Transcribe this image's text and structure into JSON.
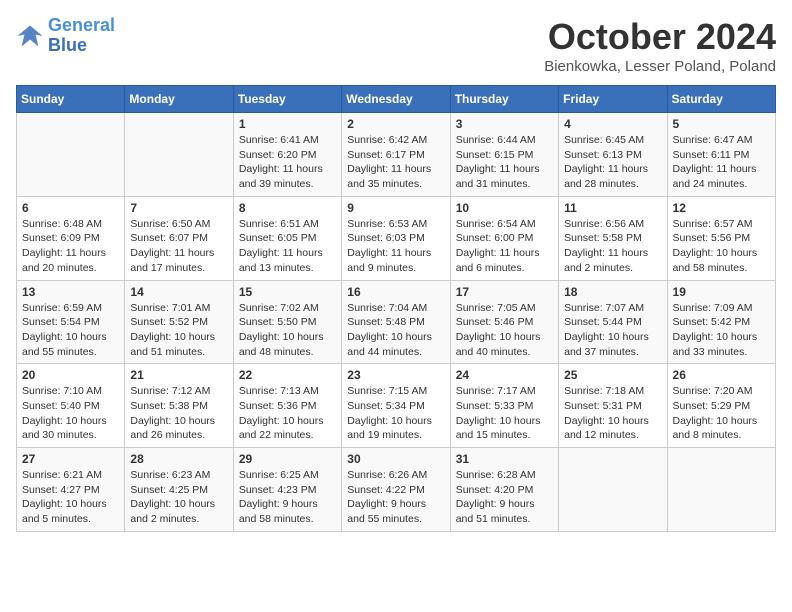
{
  "header": {
    "logo_line1": "General",
    "logo_line2": "Blue",
    "month": "October 2024",
    "location": "Bienkowka, Lesser Poland, Poland"
  },
  "days_of_week": [
    "Sunday",
    "Monday",
    "Tuesday",
    "Wednesday",
    "Thursday",
    "Friday",
    "Saturday"
  ],
  "weeks": [
    [
      {
        "day": "",
        "info": ""
      },
      {
        "day": "",
        "info": ""
      },
      {
        "day": "1",
        "info": "Sunrise: 6:41 AM\nSunset: 6:20 PM\nDaylight: 11 hours and 39 minutes."
      },
      {
        "day": "2",
        "info": "Sunrise: 6:42 AM\nSunset: 6:17 PM\nDaylight: 11 hours and 35 minutes."
      },
      {
        "day": "3",
        "info": "Sunrise: 6:44 AM\nSunset: 6:15 PM\nDaylight: 11 hours and 31 minutes."
      },
      {
        "day": "4",
        "info": "Sunrise: 6:45 AM\nSunset: 6:13 PM\nDaylight: 11 hours and 28 minutes."
      },
      {
        "day": "5",
        "info": "Sunrise: 6:47 AM\nSunset: 6:11 PM\nDaylight: 11 hours and 24 minutes."
      }
    ],
    [
      {
        "day": "6",
        "info": "Sunrise: 6:48 AM\nSunset: 6:09 PM\nDaylight: 11 hours and 20 minutes."
      },
      {
        "day": "7",
        "info": "Sunrise: 6:50 AM\nSunset: 6:07 PM\nDaylight: 11 hours and 17 minutes."
      },
      {
        "day": "8",
        "info": "Sunrise: 6:51 AM\nSunset: 6:05 PM\nDaylight: 11 hours and 13 minutes."
      },
      {
        "day": "9",
        "info": "Sunrise: 6:53 AM\nSunset: 6:03 PM\nDaylight: 11 hours and 9 minutes."
      },
      {
        "day": "10",
        "info": "Sunrise: 6:54 AM\nSunset: 6:00 PM\nDaylight: 11 hours and 6 minutes."
      },
      {
        "day": "11",
        "info": "Sunrise: 6:56 AM\nSunset: 5:58 PM\nDaylight: 11 hours and 2 minutes."
      },
      {
        "day": "12",
        "info": "Sunrise: 6:57 AM\nSunset: 5:56 PM\nDaylight: 10 hours and 58 minutes."
      }
    ],
    [
      {
        "day": "13",
        "info": "Sunrise: 6:59 AM\nSunset: 5:54 PM\nDaylight: 10 hours and 55 minutes."
      },
      {
        "day": "14",
        "info": "Sunrise: 7:01 AM\nSunset: 5:52 PM\nDaylight: 10 hours and 51 minutes."
      },
      {
        "day": "15",
        "info": "Sunrise: 7:02 AM\nSunset: 5:50 PM\nDaylight: 10 hours and 48 minutes."
      },
      {
        "day": "16",
        "info": "Sunrise: 7:04 AM\nSunset: 5:48 PM\nDaylight: 10 hours and 44 minutes."
      },
      {
        "day": "17",
        "info": "Sunrise: 7:05 AM\nSunset: 5:46 PM\nDaylight: 10 hours and 40 minutes."
      },
      {
        "day": "18",
        "info": "Sunrise: 7:07 AM\nSunset: 5:44 PM\nDaylight: 10 hours and 37 minutes."
      },
      {
        "day": "19",
        "info": "Sunrise: 7:09 AM\nSunset: 5:42 PM\nDaylight: 10 hours and 33 minutes."
      }
    ],
    [
      {
        "day": "20",
        "info": "Sunrise: 7:10 AM\nSunset: 5:40 PM\nDaylight: 10 hours and 30 minutes."
      },
      {
        "day": "21",
        "info": "Sunrise: 7:12 AM\nSunset: 5:38 PM\nDaylight: 10 hours and 26 minutes."
      },
      {
        "day": "22",
        "info": "Sunrise: 7:13 AM\nSunset: 5:36 PM\nDaylight: 10 hours and 22 minutes."
      },
      {
        "day": "23",
        "info": "Sunrise: 7:15 AM\nSunset: 5:34 PM\nDaylight: 10 hours and 19 minutes."
      },
      {
        "day": "24",
        "info": "Sunrise: 7:17 AM\nSunset: 5:33 PM\nDaylight: 10 hours and 15 minutes."
      },
      {
        "day": "25",
        "info": "Sunrise: 7:18 AM\nSunset: 5:31 PM\nDaylight: 10 hours and 12 minutes."
      },
      {
        "day": "26",
        "info": "Sunrise: 7:20 AM\nSunset: 5:29 PM\nDaylight: 10 hours and 8 minutes."
      }
    ],
    [
      {
        "day": "27",
        "info": "Sunrise: 6:21 AM\nSunset: 4:27 PM\nDaylight: 10 hours and 5 minutes."
      },
      {
        "day": "28",
        "info": "Sunrise: 6:23 AM\nSunset: 4:25 PM\nDaylight: 10 hours and 2 minutes."
      },
      {
        "day": "29",
        "info": "Sunrise: 6:25 AM\nSunset: 4:23 PM\nDaylight: 9 hours and 58 minutes."
      },
      {
        "day": "30",
        "info": "Sunrise: 6:26 AM\nSunset: 4:22 PM\nDaylight: 9 hours and 55 minutes."
      },
      {
        "day": "31",
        "info": "Sunrise: 6:28 AM\nSunset: 4:20 PM\nDaylight: 9 hours and 51 minutes."
      },
      {
        "day": "",
        "info": ""
      },
      {
        "day": "",
        "info": ""
      }
    ]
  ]
}
